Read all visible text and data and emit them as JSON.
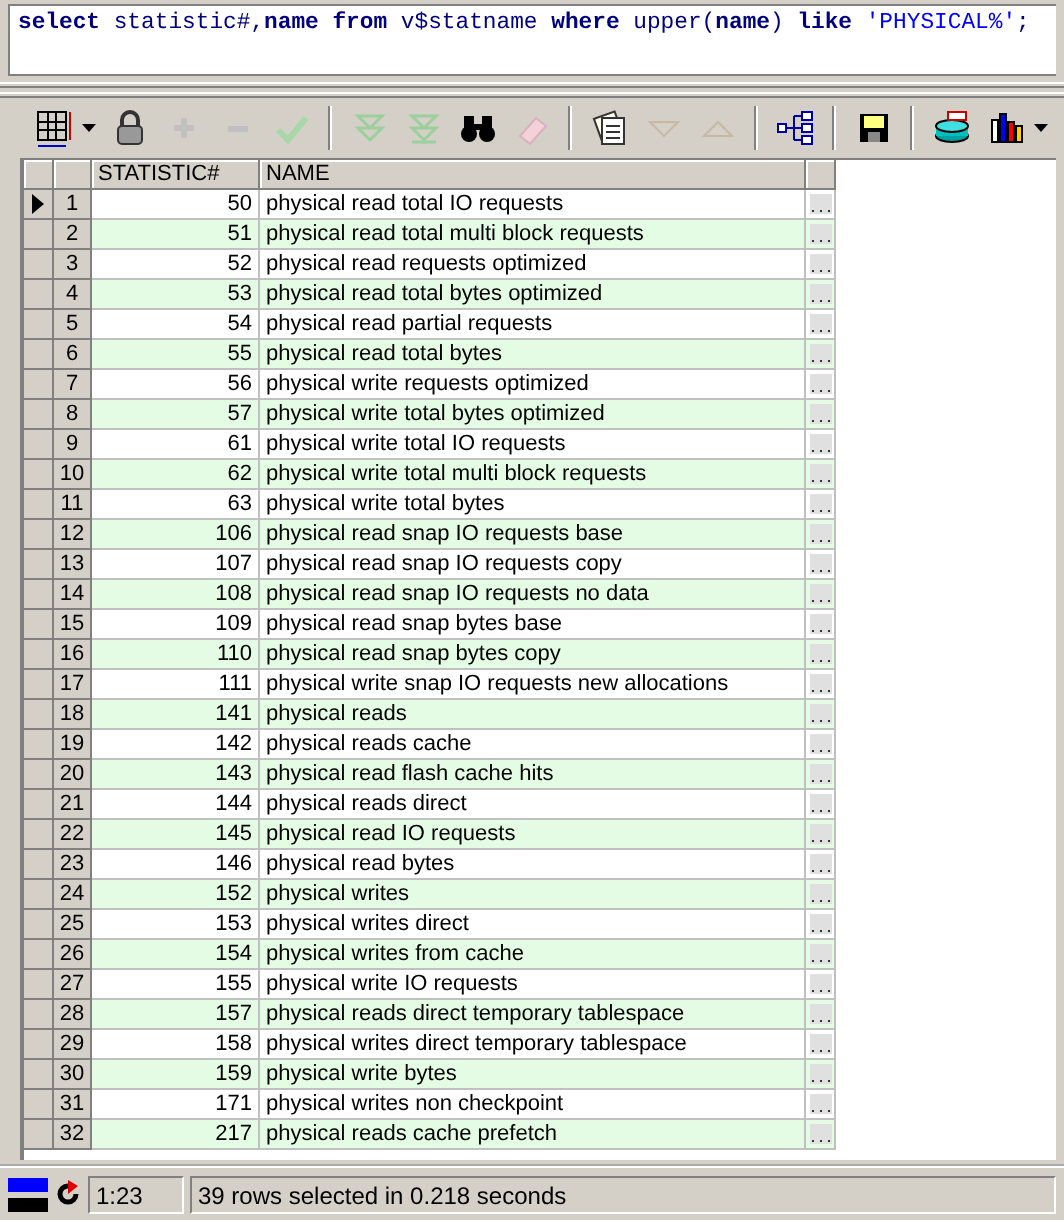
{
  "editor": {
    "sql": [
      {
        "kind": "keyword",
        "text": "select"
      },
      {
        "kind": "plain",
        "text": " statistic#,"
      },
      {
        "kind": "keyword",
        "text": "name"
      },
      {
        "kind": "keyword",
        "text": " from"
      },
      {
        "kind": "plain",
        "text": " v$statname "
      },
      {
        "kind": "keyword",
        "text": "where"
      },
      {
        "kind": "plain",
        "text": " upper("
      },
      {
        "kind": "keyword",
        "text": "name"
      },
      {
        "kind": "plain",
        "text": ") "
      },
      {
        "kind": "keyword",
        "text": "like"
      },
      {
        "kind": "string",
        "text": " 'PHYSICAL%'"
      },
      {
        "kind": "plain",
        "text": ";"
      }
    ]
  },
  "table": {
    "columns": [
      "STATISTIC#",
      "NAME"
    ],
    "rows": [
      {
        "num": "1",
        "statistic": "50",
        "name": "physical read total IO requests",
        "selected": true
      },
      {
        "num": "2",
        "statistic": "51",
        "name": "physical read total multi block requests",
        "selected": false
      },
      {
        "num": "3",
        "statistic": "52",
        "name": "physical read requests optimized",
        "selected": false
      },
      {
        "num": "4",
        "statistic": "53",
        "name": "physical read total bytes optimized",
        "selected": false
      },
      {
        "num": "5",
        "statistic": "54",
        "name": "physical read partial requests",
        "selected": false
      },
      {
        "num": "6",
        "statistic": "55",
        "name": "physical read total bytes",
        "selected": false
      },
      {
        "num": "7",
        "statistic": "56",
        "name": "physical write requests optimized",
        "selected": false
      },
      {
        "num": "8",
        "statistic": "57",
        "name": "physical write total bytes optimized",
        "selected": false
      },
      {
        "num": "9",
        "statistic": "61",
        "name": "physical write total IO requests",
        "selected": false
      },
      {
        "num": "10",
        "statistic": "62",
        "name": "physical write total multi block requests",
        "selected": false
      },
      {
        "num": "11",
        "statistic": "63",
        "name": "physical write total bytes",
        "selected": false
      },
      {
        "num": "12",
        "statistic": "106",
        "name": "physical read snap IO requests base",
        "selected": false
      },
      {
        "num": "13",
        "statistic": "107",
        "name": "physical read snap IO requests copy",
        "selected": false
      },
      {
        "num": "14",
        "statistic": "108",
        "name": "physical read snap IO requests no data",
        "selected": false
      },
      {
        "num": "15",
        "statistic": "109",
        "name": "physical read snap bytes base",
        "selected": false
      },
      {
        "num": "16",
        "statistic": "110",
        "name": "physical read snap bytes copy",
        "selected": false
      },
      {
        "num": "17",
        "statistic": "111",
        "name": "physical write snap IO requests new allocations",
        "selected": false
      },
      {
        "num": "18",
        "statistic": "141",
        "name": "physical reads",
        "selected": false
      },
      {
        "num": "19",
        "statistic": "142",
        "name": "physical reads cache",
        "selected": false
      },
      {
        "num": "20",
        "statistic": "143",
        "name": "physical read flash cache hits",
        "selected": false
      },
      {
        "num": "21",
        "statistic": "144",
        "name": "physical reads direct",
        "selected": false
      },
      {
        "num": "22",
        "statistic": "145",
        "name": "physical read IO requests",
        "selected": false
      },
      {
        "num": "23",
        "statistic": "146",
        "name": "physical read bytes",
        "selected": false
      },
      {
        "num": "24",
        "statistic": "152",
        "name": "physical writes",
        "selected": false
      },
      {
        "num": "25",
        "statistic": "153",
        "name": "physical writes direct",
        "selected": false
      },
      {
        "num": "26",
        "statistic": "154",
        "name": "physical writes from cache",
        "selected": false
      },
      {
        "num": "27",
        "statistic": "155",
        "name": "physical write IO requests",
        "selected": false
      },
      {
        "num": "28",
        "statistic": "157",
        "name": "physical reads direct temporary tablespace",
        "selected": false
      },
      {
        "num": "29",
        "statistic": "158",
        "name": "physical writes direct temporary tablespace",
        "selected": false
      },
      {
        "num": "30",
        "statistic": "159",
        "name": "physical write bytes",
        "selected": false
      },
      {
        "num": "31",
        "statistic": "171",
        "name": "physical writes non checkpoint",
        "selected": false
      },
      {
        "num": "32",
        "statistic": "217",
        "name": "physical reads cache prefetch",
        "selected": false
      }
    ]
  },
  "status_bar": {
    "position": "1:23",
    "message": "39 rows selected in 0.218 seconds"
  }
}
